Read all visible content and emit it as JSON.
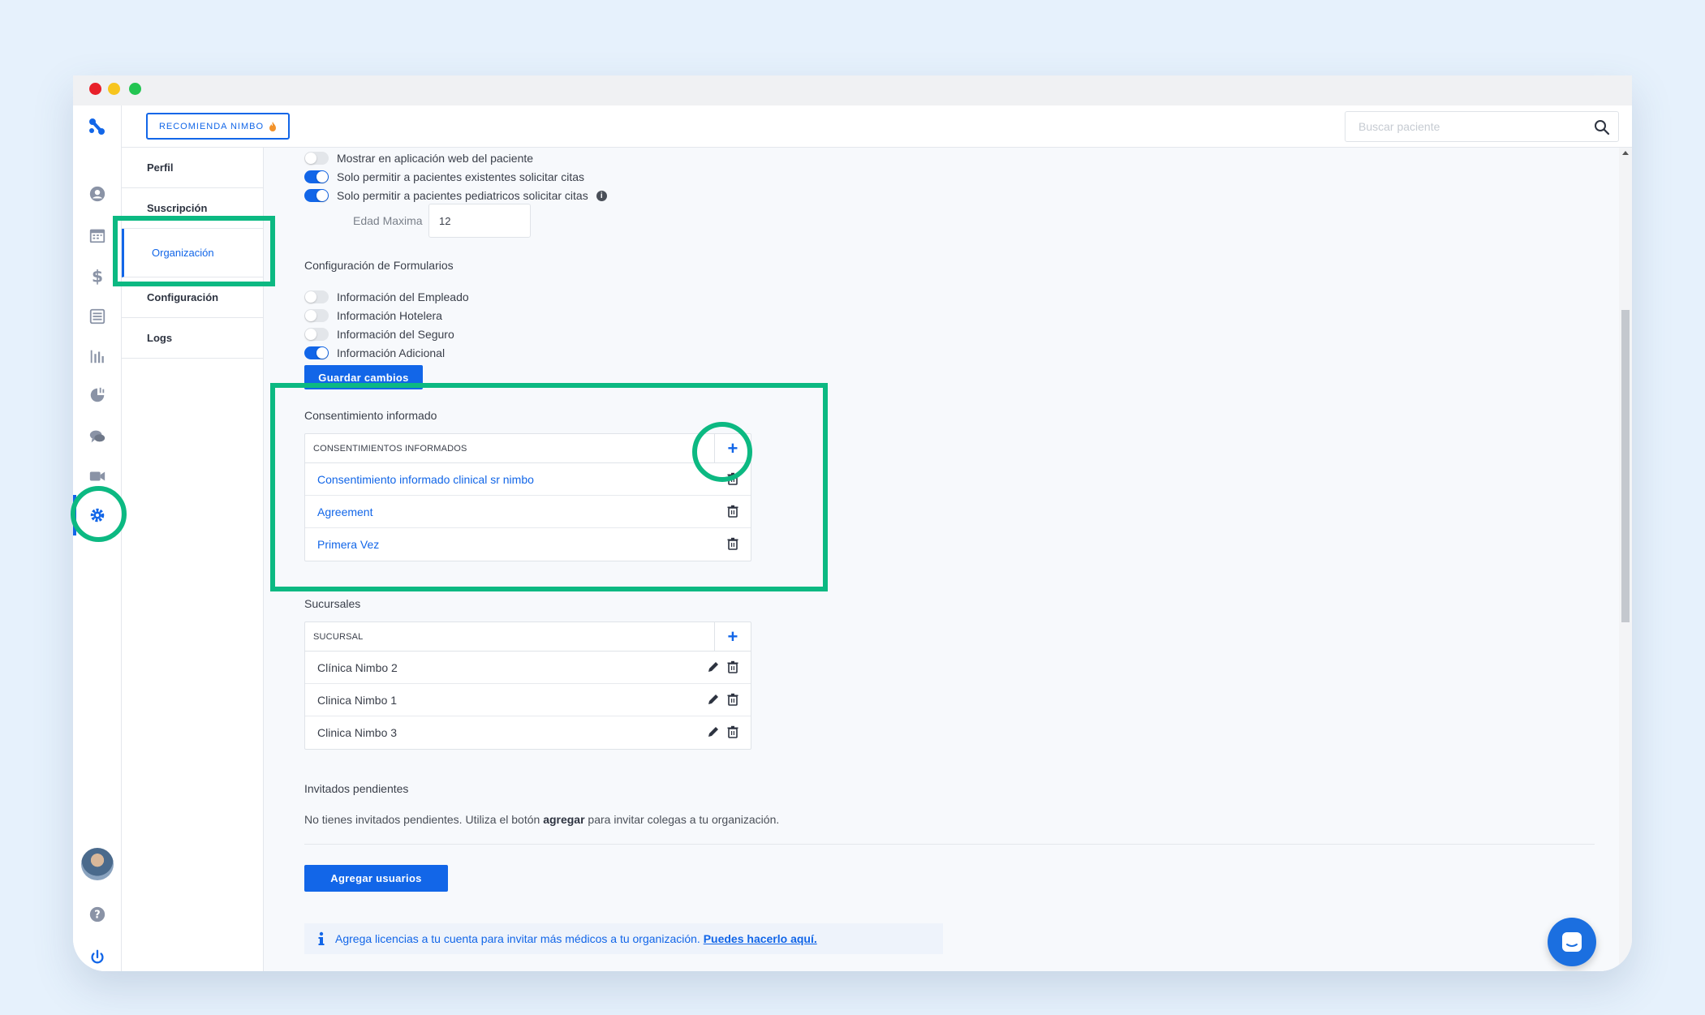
{
  "header": {
    "recommend_label": "RECOMIENDA NIMBO",
    "search_placeholder": "Buscar paciente"
  },
  "subnav": {
    "items": [
      {
        "label": "Perfil"
      },
      {
        "label": "Suscripción"
      },
      {
        "label": "Organización",
        "active": true
      },
      {
        "label": "Configuración"
      },
      {
        "label": "Logs"
      }
    ]
  },
  "sidebar_icons": [
    "user-icon",
    "calendar-icon",
    "dollar-icon",
    "list-icon",
    "bar-chart-icon",
    "analytics-icon",
    "chat-icon",
    "video-icon",
    "gear-icon",
    "help-icon",
    "power-icon"
  ],
  "settings": {
    "toggles": [
      {
        "label": "Mostrar en aplicación web del paciente",
        "on": false
      },
      {
        "label": "Solo permitir a pacientes existentes solicitar citas",
        "on": true
      },
      {
        "label": "Solo permitir a pacientes pediatricos solicitar citas",
        "on": true
      }
    ],
    "age_label": "Edad Maxima",
    "age_value": "12"
  },
  "forms": {
    "title": "Configuración de Formularios",
    "toggles": [
      {
        "label": "Información del Empleado",
        "on": false
      },
      {
        "label": "Información Hotelera",
        "on": false
      },
      {
        "label": "Información del Seguro",
        "on": false
      },
      {
        "label": "Información Adicional",
        "on": true
      }
    ],
    "save_label": "Guardar cambios"
  },
  "consent": {
    "title": "Consentimiento informado",
    "header": "CONSENTIMIENTOS INFORMADOS",
    "add_label": "+",
    "rows": [
      "Consentimiento informado clinical sr nimbo",
      "Agreement",
      "Primera Vez"
    ]
  },
  "branches": {
    "title": "Sucursales",
    "header": "SUCURSAL",
    "add_label": "+",
    "rows": [
      "Clínica Nimbo 2",
      "Clinica Nimbo 1",
      "Clinica Nimbo 3"
    ]
  },
  "pending": {
    "title": "Invitados pendientes",
    "text_before": "No tienes invitados pendientes. Utiliza el botón ",
    "text_bold": "agregar",
    "text_after": " para invitar colegas a tu organización.",
    "add_users_label": "Agregar usuarios"
  },
  "notice": {
    "text": "Agrega licencias a tu cuenta para invitar más médicos a tu organización.",
    "link": "Puedes hacerlo aquí."
  },
  "colors": {
    "accent": "#1266e8",
    "highlight": "#0cb982"
  }
}
